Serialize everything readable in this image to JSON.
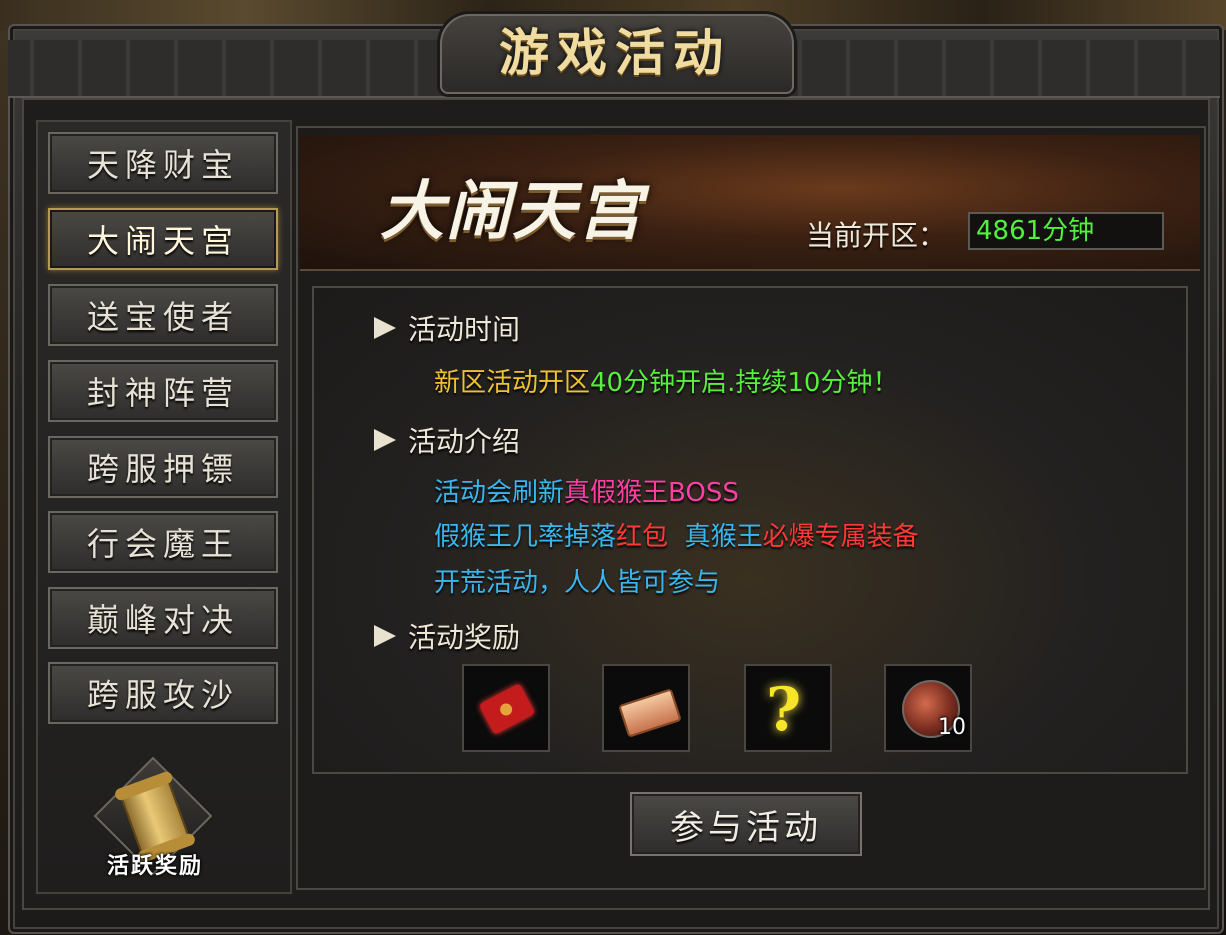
{
  "window": {
    "title": "游戏活动"
  },
  "sidebar": {
    "items": [
      {
        "label": "天降财宝",
        "active": false
      },
      {
        "label": "大闹天宫",
        "active": true
      },
      {
        "label": "送宝使者",
        "active": false
      },
      {
        "label": "封神阵营",
        "active": false
      },
      {
        "label": "跨服押镖",
        "active": false
      },
      {
        "label": "行会魔王",
        "active": false
      },
      {
        "label": "巅峰对决",
        "active": false
      },
      {
        "label": "跨服攻沙",
        "active": false
      }
    ],
    "reward_label": "活跃奖励"
  },
  "banner": {
    "title": "大闹天宫",
    "server_label": "当前开区：",
    "server_value": "4861分钟"
  },
  "sections": {
    "time": {
      "heading": "活动时间",
      "line1": {
        "p1": "新区活动开区",
        "p2": "40分钟开启.持续10分钟！"
      }
    },
    "intro": {
      "heading": "活动介绍",
      "line1": {
        "p1": "活动会刷新",
        "p2": "真假猴王BOSS"
      },
      "line2": {
        "p1": "假猴王几率掉落",
        "p2": "红包",
        "p3": "真猴王",
        "p4": "必爆专属装备"
      },
      "line3": {
        "p1": "开荒活动，人人皆可参与"
      }
    },
    "rewards": {
      "heading": "活动奖励",
      "items": [
        {
          "icon": "red-envelope-icon",
          "count": null
        },
        {
          "icon": "gold-bar-icon",
          "count": null
        },
        {
          "icon": "golden-hook-icon",
          "count": null
        },
        {
          "icon": "monkey-orb-icon",
          "count": "10"
        }
      ]
    }
  },
  "actions": {
    "join_label": "参与活动"
  },
  "colors": {
    "gold": "#f0c232",
    "green": "#56f03c",
    "blue": "#3ab6ee",
    "magenta": "#ff3fa4",
    "red": "#ff3838"
  }
}
